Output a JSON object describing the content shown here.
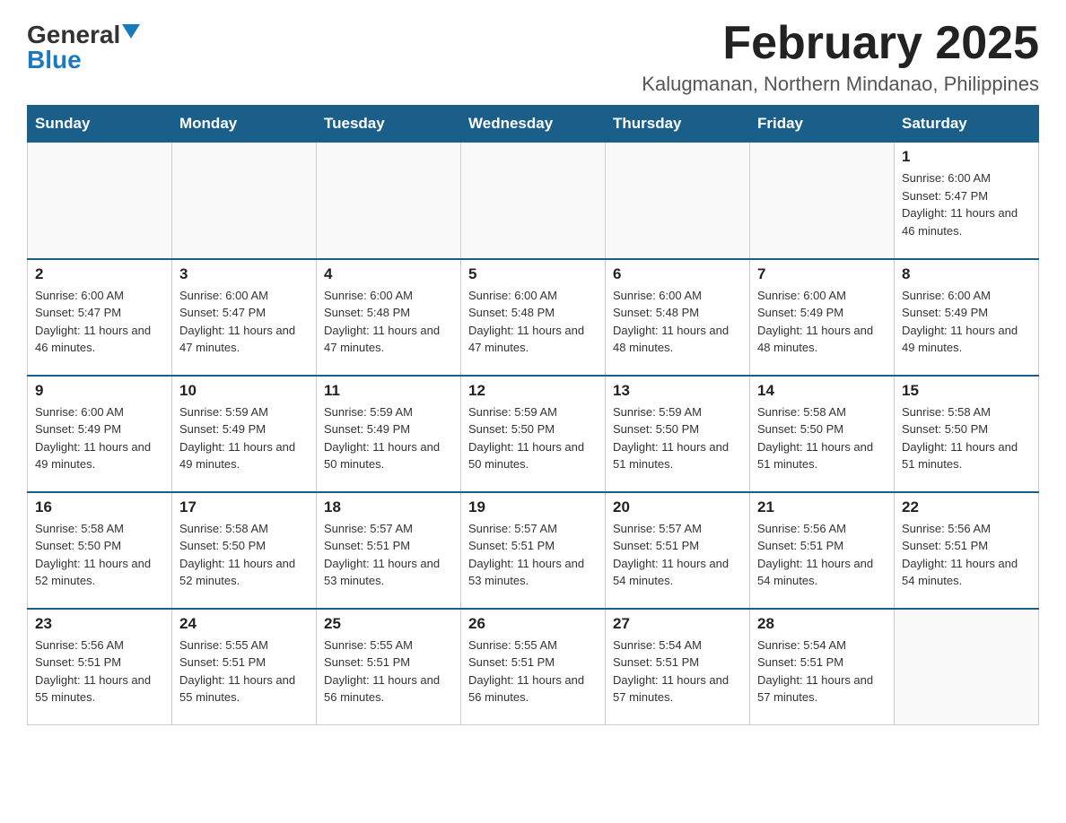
{
  "header": {
    "logo_general": "General",
    "logo_blue": "Blue",
    "title": "February 2025",
    "subtitle": "Kalugmanan, Northern Mindanao, Philippines"
  },
  "days_of_week": [
    "Sunday",
    "Monday",
    "Tuesday",
    "Wednesday",
    "Thursday",
    "Friday",
    "Saturday"
  ],
  "weeks": [
    [
      {
        "day": "",
        "info": ""
      },
      {
        "day": "",
        "info": ""
      },
      {
        "day": "",
        "info": ""
      },
      {
        "day": "",
        "info": ""
      },
      {
        "day": "",
        "info": ""
      },
      {
        "day": "",
        "info": ""
      },
      {
        "day": "1",
        "info": "Sunrise: 6:00 AM\nSunset: 5:47 PM\nDaylight: 11 hours and 46 minutes."
      }
    ],
    [
      {
        "day": "2",
        "info": "Sunrise: 6:00 AM\nSunset: 5:47 PM\nDaylight: 11 hours and 46 minutes."
      },
      {
        "day": "3",
        "info": "Sunrise: 6:00 AM\nSunset: 5:47 PM\nDaylight: 11 hours and 47 minutes."
      },
      {
        "day": "4",
        "info": "Sunrise: 6:00 AM\nSunset: 5:48 PM\nDaylight: 11 hours and 47 minutes."
      },
      {
        "day": "5",
        "info": "Sunrise: 6:00 AM\nSunset: 5:48 PM\nDaylight: 11 hours and 47 minutes."
      },
      {
        "day": "6",
        "info": "Sunrise: 6:00 AM\nSunset: 5:48 PM\nDaylight: 11 hours and 48 minutes."
      },
      {
        "day": "7",
        "info": "Sunrise: 6:00 AM\nSunset: 5:49 PM\nDaylight: 11 hours and 48 minutes."
      },
      {
        "day": "8",
        "info": "Sunrise: 6:00 AM\nSunset: 5:49 PM\nDaylight: 11 hours and 49 minutes."
      }
    ],
    [
      {
        "day": "9",
        "info": "Sunrise: 6:00 AM\nSunset: 5:49 PM\nDaylight: 11 hours and 49 minutes."
      },
      {
        "day": "10",
        "info": "Sunrise: 5:59 AM\nSunset: 5:49 PM\nDaylight: 11 hours and 49 minutes."
      },
      {
        "day": "11",
        "info": "Sunrise: 5:59 AM\nSunset: 5:49 PM\nDaylight: 11 hours and 50 minutes."
      },
      {
        "day": "12",
        "info": "Sunrise: 5:59 AM\nSunset: 5:50 PM\nDaylight: 11 hours and 50 minutes."
      },
      {
        "day": "13",
        "info": "Sunrise: 5:59 AM\nSunset: 5:50 PM\nDaylight: 11 hours and 51 minutes."
      },
      {
        "day": "14",
        "info": "Sunrise: 5:58 AM\nSunset: 5:50 PM\nDaylight: 11 hours and 51 minutes."
      },
      {
        "day": "15",
        "info": "Sunrise: 5:58 AM\nSunset: 5:50 PM\nDaylight: 11 hours and 51 minutes."
      }
    ],
    [
      {
        "day": "16",
        "info": "Sunrise: 5:58 AM\nSunset: 5:50 PM\nDaylight: 11 hours and 52 minutes."
      },
      {
        "day": "17",
        "info": "Sunrise: 5:58 AM\nSunset: 5:50 PM\nDaylight: 11 hours and 52 minutes."
      },
      {
        "day": "18",
        "info": "Sunrise: 5:57 AM\nSunset: 5:51 PM\nDaylight: 11 hours and 53 minutes."
      },
      {
        "day": "19",
        "info": "Sunrise: 5:57 AM\nSunset: 5:51 PM\nDaylight: 11 hours and 53 minutes."
      },
      {
        "day": "20",
        "info": "Sunrise: 5:57 AM\nSunset: 5:51 PM\nDaylight: 11 hours and 54 minutes."
      },
      {
        "day": "21",
        "info": "Sunrise: 5:56 AM\nSunset: 5:51 PM\nDaylight: 11 hours and 54 minutes."
      },
      {
        "day": "22",
        "info": "Sunrise: 5:56 AM\nSunset: 5:51 PM\nDaylight: 11 hours and 54 minutes."
      }
    ],
    [
      {
        "day": "23",
        "info": "Sunrise: 5:56 AM\nSunset: 5:51 PM\nDaylight: 11 hours and 55 minutes."
      },
      {
        "day": "24",
        "info": "Sunrise: 5:55 AM\nSunset: 5:51 PM\nDaylight: 11 hours and 55 minutes."
      },
      {
        "day": "25",
        "info": "Sunrise: 5:55 AM\nSunset: 5:51 PM\nDaylight: 11 hours and 56 minutes."
      },
      {
        "day": "26",
        "info": "Sunrise: 5:55 AM\nSunset: 5:51 PM\nDaylight: 11 hours and 56 minutes."
      },
      {
        "day": "27",
        "info": "Sunrise: 5:54 AM\nSunset: 5:51 PM\nDaylight: 11 hours and 57 minutes."
      },
      {
        "day": "28",
        "info": "Sunrise: 5:54 AM\nSunset: 5:51 PM\nDaylight: 11 hours and 57 minutes."
      },
      {
        "day": "",
        "info": ""
      }
    ]
  ]
}
